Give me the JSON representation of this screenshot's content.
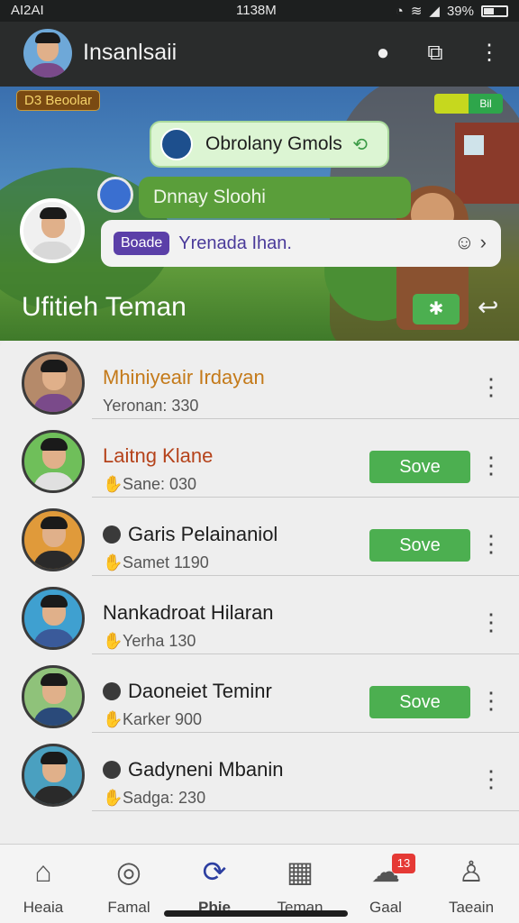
{
  "status_bar": {
    "carrier": "AI2AI",
    "time": "1138M",
    "battery": "39%"
  },
  "app_bar": {
    "title": "Insanlsaii"
  },
  "hero": {
    "tag_left": "Beoolar",
    "tag_left_prefix": "D3",
    "tag_right": "Bil",
    "bubble_top": "Obrolany Gmols",
    "bubble_green": "Dnnay Sloohi",
    "bubble_pill": "Boade",
    "bubble_text": "Yrenada Ihan.",
    "title": "Ufitieh Teman"
  },
  "friends": [
    {
      "name": "Mhiniyeair Irdayan",
      "status": "Yeronan: 330",
      "has_button": false,
      "color": "#c47a1a",
      "body_color": "#7a4a8a",
      "bg": "#b58a6a"
    },
    {
      "name": "Laitng Klane",
      "status": "Sane: 030",
      "has_button": true,
      "color": "#b5431b",
      "body_color": "#e0e0e0",
      "bg": "#6fbf5a"
    },
    {
      "name": "Garis Pelainaniol",
      "status": "Samet 1190",
      "has_button": true,
      "color": "#1e1e1e",
      "body_color": "#2a2a2a",
      "bg": "#e09a3a"
    },
    {
      "name": "Nankadroat Hilaran",
      "status": "Yerha 130",
      "has_button": false,
      "color": "#1e1e1e",
      "body_color": "#3a5a9a",
      "bg": "#3fa0d0"
    },
    {
      "name": "Daoneiet Teminr",
      "status": "Karker 900",
      "has_button": true,
      "color": "#1e1e1e",
      "body_color": "#2a4a7a",
      "bg": "#8fc27a"
    },
    {
      "name": "Gadyneni Mbanin",
      "status": "Sadga: 230",
      "has_button": false,
      "color": "#1e1e1e",
      "body_color": "#2a2a2a",
      "bg": "#4aa0c0"
    }
  ],
  "button_label": "Sove",
  "nav": [
    {
      "label": "Heaia",
      "icon": "home-icon"
    },
    {
      "label": "Famal",
      "icon": "compass-icon"
    },
    {
      "label": "Pbie",
      "icon": "refresh-icon"
    },
    {
      "label": "Teman",
      "icon": "grid-icon"
    },
    {
      "label": "Gaal",
      "icon": "chat-icon",
      "badge": "13"
    },
    {
      "label": "Taeain",
      "icon": "user-icon"
    }
  ]
}
